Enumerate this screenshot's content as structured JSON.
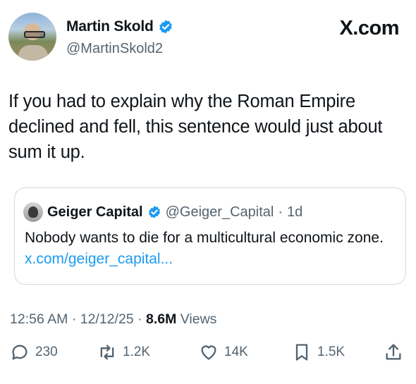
{
  "header": {
    "display_name": "Martin Skold",
    "handle": "@MartinSkold2",
    "brand": "X.com",
    "verified_color": "#1d9bf0"
  },
  "tweet": {
    "text": "If you had to explain why the Roman Empire declined and fell, this sentence would just about sum it up."
  },
  "quote": {
    "display_name": "Geiger Capital",
    "handle": "@Geiger_Capital",
    "separator": "·",
    "age": "1d",
    "text": "Nobody wants to die for a multicultural economic zone.",
    "link_text": "x.com/geiger_capital..."
  },
  "meta": {
    "time": "12:56 AM",
    "separator": "·",
    "date": "12/12/25",
    "views_count": "8.6M",
    "views_label": "Views"
  },
  "actions": {
    "replies": "230",
    "reposts": "1.2K",
    "likes": "14K",
    "bookmarks": "1.5K"
  },
  "icons": [
    "verified-badge-icon",
    "reply-icon",
    "repost-icon",
    "like-icon",
    "bookmark-icon",
    "share-icon"
  ],
  "colors": {
    "link": "#1d9bf0",
    "secondary_text": "#536471",
    "primary_text": "#0f1419"
  }
}
